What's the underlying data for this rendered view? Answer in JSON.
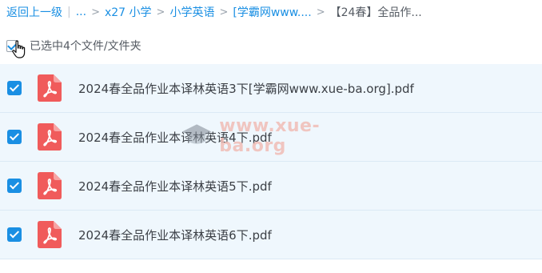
{
  "breadcrumb": {
    "back": "返回上一级",
    "ellipsis": "...",
    "items": [
      "x27 小学",
      "小学英语",
      "[学霸网www...."
    ],
    "current": "【24春】全品作..."
  },
  "selection": {
    "label": "已选中4个文件/文件夹"
  },
  "files": [
    {
      "name": "2024春全品作业本译林英语3下[学霸网www.xue-ba.org].pdf",
      "selected": true
    },
    {
      "name": "2024春全品作业本译林英语4下.pdf",
      "selected": true
    },
    {
      "name": "2024春全品作业本译林英语5下.pdf",
      "selected": true
    },
    {
      "name": "2024春全品作业本译林英语6下.pdf",
      "selected": true
    }
  ],
  "watermark": {
    "text": "www.xue-ba.org",
    "icon": "graduation-cap-icon"
  },
  "colors": {
    "accent": "#1a8fe3",
    "row_bg": "#eff7fd",
    "pdf_red": "#f05b5b"
  }
}
